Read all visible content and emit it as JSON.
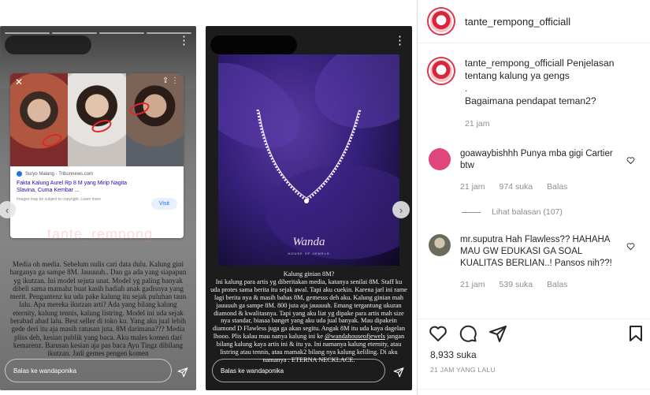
{
  "post": {
    "username": "tante_rempong_officiall",
    "caption_user": "tante_rempong_officiall",
    "caption_lines": [
      "Penjelasan",
      "tentang kalung ya gengs",
      ".",
      "Bagaimana pendapat teman2?"
    ],
    "caption_time": "21 jam",
    "likes": "8,933 suka",
    "date": "21 JAM YANG LALU"
  },
  "comments": [
    {
      "user": "goawaybishhh",
      "text": "Punya mba gigi Cartier btw",
      "time": "21 jam",
      "likes": "974 suka",
      "reply": "Balas",
      "avatar_color": "#e0467c"
    },
    {
      "user": "mr.suputra",
      "text": "Hah Flawless?? HAHAHA MAU GW EDUKASI GA SOAL KUALITAS BERLIAN..! Pansos nih??!",
      "time": "21 jam",
      "likes": "539 suka",
      "reply": "Balas",
      "avatar_color": "#8b8b7a"
    }
  ],
  "view_replies": "Lihat balasan (107)",
  "story_left": {
    "news_source": "Suryo Malang - Tribunnews.com",
    "news_title": "Fakta Kalung Aurel Rp 8 M yang Mirip Nagita Slavina, Cuma Kembar ...",
    "news_note": "Images may be subject to copyright. Learn more",
    "visit": "Visit",
    "watermark": "tante_rempong",
    "text": "Media oh media. Sebelum nulis cari data dulu. Kalung gini harganya ga sampe 8M. Jauuuuh.. Dan ga ada yang siapapun yg ikutzan. Ini model sejuta unat. Model yg paling banyak dibeli sama mamahz buat kasih hadiah anak gadisnya yang merit. Pengantenz ku uda pake kalung itu sejak puluhan taun lalu. Apa mereka ikutzan arti? Ada yang bilang kalung eternity, kalung tennis, kalung listring. Model ini uda sejak berabad abad lalu. Best seller di toko ku. Yang aku jual lebih gede deri itu aja masih ratusan juta. 8M darimana??? Media pliss deh, kesian publik yang baca. Aku males komen dari kemarenz. Barusan kesian aja pas baca Ayu Tingz dibilang ikutzan. Jadi gemes pengen komen",
    "reply_placeholder": "Balas ke wandaponika"
  },
  "story_right": {
    "brand": "Wanda",
    "brand_sub": "HOUSE OF JEWELS",
    "text_intro": "Kalung ginian 8M?",
    "text_body": "Ini kalung para artis yg diberitakan media, katanya senilai 8M. Staff ku uda protes sama berita itu sejak awal. Tapi aku cuekin. Karena jarl ini rame lagi berita nya & masih bahas 8M, gemesss deh aku. Kalung ginian mah jauuuuh ga sampe 8M. 800 juta aja jauuuuh. Emang tergantung ukuran diamond & kwalitasnya. Tapi yang aku liat yg dipake para artis mah size nya standar, biasaa banget yang aku uda jual banyak. Mau dipakein diamond D Flawless juga ga akan segitu. Angak 8M itu uda kaya dagelan lhooo. Plis kalau mau nanya kalung ini ke",
    "text_handle": "@wandahouseofjewels",
    "text_tail": "jangan bilang kalung kaya artis ini & itu ya. Ini namanya kalung eternity, atau listring atau tennis, atau mamak2 bilang nya kalung keliling. Di aku namanya : ETERNA NECKLACE.",
    "reply_placeholder": "Balas ke wandaponika"
  },
  "icons": {
    "heart": "heart-icon",
    "comment": "comment-icon",
    "share": "share-icon",
    "save": "bookmark-icon"
  }
}
